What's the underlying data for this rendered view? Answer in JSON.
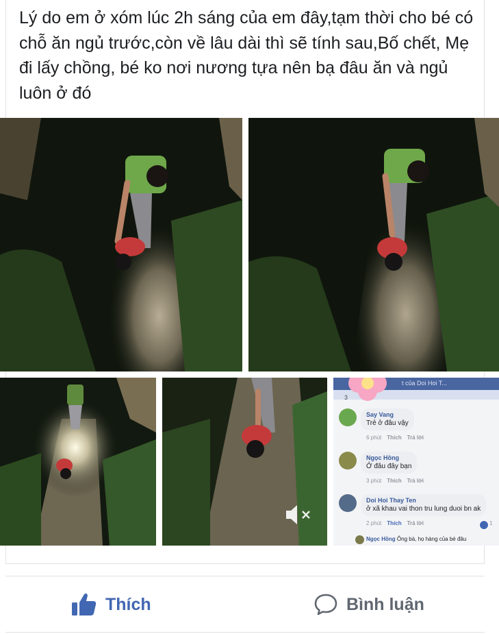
{
  "post": {
    "text": "Lý do em ở xóm lúc 2h sáng của em đây,tạm thời cho bé có chỗ ăn ngủ trước,còn về lâu dài thì sẽ tính sau,Bố chết, Mẹ đi lấy chồng, bé ko nơi nương tựa nên bạ đâu ăn và ngủ luôn ở đó"
  },
  "screenshot": {
    "header_text": "t của Doi Hoi T...",
    "reaction_count": "3",
    "comments": [
      {
        "name": "Say Vang",
        "text": "Trẻ ở đâu vậy",
        "time": "6 phút",
        "like": "Thích",
        "reply": "Trả lời"
      },
      {
        "name": "Ngọc Hồng",
        "text": "Ở đâu đây bạn",
        "time": "3 phút",
        "like": "Thích",
        "reply": "Trả lời"
      },
      {
        "name": "Doi Hoi Thay Ten",
        "text": "ở xã khau vai thon tru lung duoi bn ak",
        "time": "2 phút",
        "like": "Thích",
        "reply": "Trả lời",
        "reactions": "1"
      }
    ],
    "last_comment": {
      "name": "Ngọc Hồng",
      "text": "Ông bà, họ hàng của bé đâu"
    }
  },
  "actions": {
    "like_label": "Thích",
    "comment_label": "Bình luận"
  },
  "colors": {
    "brand_blue": "#4267b2",
    "muted_gray": "#606770"
  }
}
